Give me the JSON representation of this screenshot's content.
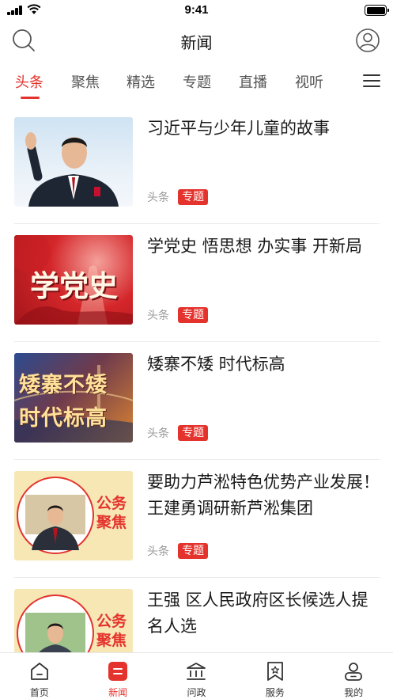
{
  "status_bar": {
    "time": "9:41"
  },
  "header": {
    "title": "新闻",
    "search_icon": "search-icon",
    "user_icon": "user-icon"
  },
  "tabs": [
    {
      "label": "头条",
      "active": true
    },
    {
      "label": "聚焦",
      "active": false
    },
    {
      "label": "精选",
      "active": false
    },
    {
      "label": "专题",
      "active": false
    },
    {
      "label": "直播",
      "active": false
    },
    {
      "label": "视听",
      "active": false
    }
  ],
  "news": [
    {
      "title": "习近平与少年儿童的故事",
      "source": "头条",
      "tag": "专题"
    },
    {
      "title": "学党史 悟思想 办实事 开新局",
      "source": "头条",
      "tag": "专题",
      "thumb_text": "学党史"
    },
    {
      "title": "矮寨不矮  时代标高",
      "source": "头条",
      "tag": "专题",
      "thumb_text_1": "矮寨不矮",
      "thumb_text_2": "时代标高"
    },
    {
      "title": "要助力芦淞特色优势产业发展！王建勇调研新芦淞集团",
      "source": "头条",
      "tag": "专题",
      "badge_1": "公务",
      "badge_2": "聚焦"
    },
    {
      "title": "王强  区人民政府区长候选人提名人选",
      "badge_1": "公务",
      "badge_2": "聚焦"
    }
  ],
  "bottom_nav": [
    {
      "label": "首页",
      "icon": "home-icon",
      "active": false
    },
    {
      "label": "新闻",
      "icon": "news-icon",
      "active": true
    },
    {
      "label": "问政",
      "icon": "government-icon",
      "active": false
    },
    {
      "label": "服务",
      "icon": "service-bookmark-icon",
      "active": false
    },
    {
      "label": "我的",
      "icon": "profile-icon",
      "active": false
    }
  ],
  "colors": {
    "accent": "#e4332d",
    "text": "#1a1a1a",
    "muted": "#999999"
  }
}
